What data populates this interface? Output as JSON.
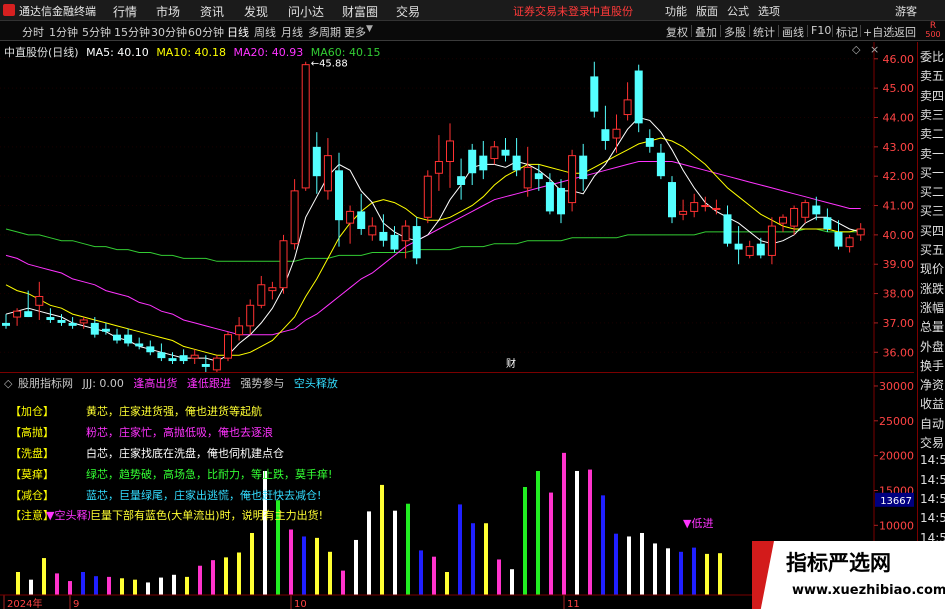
{
  "menubar": {
    "app_title": "通达信金融终端",
    "items": [
      "行情",
      "市场",
      "资讯",
      "发现",
      "问小达",
      "财富圈",
      "交易"
    ],
    "status_notice": "证券交易未登录",
    "stock_name": "中直股份",
    "right_items": [
      "功能",
      "版面",
      "公式",
      "选项"
    ],
    "guest": "游客"
  },
  "toolbar": {
    "periods": [
      "分时",
      "1分钟",
      "5分钟",
      "15分钟",
      "30分钟",
      "60分钟",
      "日线",
      "周线",
      "月线",
      "多周期",
      "更多"
    ],
    "active_period": "日线",
    "tools": [
      "复权",
      "叠加",
      "多股",
      "统计",
      "画线",
      "F10",
      "标记",
      "+自选",
      "返回"
    ],
    "badge_top": "R",
    "badge_bottom": "500"
  },
  "main_chart": {
    "title": "中直股份(日线)",
    "ma": [
      {
        "label": "MA5: 40.10",
        "color": "#ffffff"
      },
      {
        "label": "MA10: 40.18",
        "color": "#ffff00"
      },
      {
        "label": "MA20: 40.93",
        "color": "#ff33ff"
      },
      {
        "label": "MA60: 40.15",
        "color": "#33cc33"
      }
    ],
    "high_label": "45.88",
    "low_label": "34.48",
    "event_marker": "财"
  },
  "chart_data": {
    "type": "candlestick",
    "price_axis": [
      "46.00",
      "45.00",
      "44.00",
      "43.00",
      "42.00",
      "41.00",
      "40.00",
      "39.00",
      "38.00",
      "37.00",
      "36.00"
    ],
    "ylim": [
      35.6,
      46.3
    ],
    "candles": [
      [
        37.0,
        37.3,
        36.8,
        36.9
      ],
      [
        37.2,
        37.5,
        36.9,
        37.4
      ],
      [
        37.4,
        38.1,
        37.2,
        37.2
      ],
      [
        37.6,
        38.4,
        37.1,
        37.9
      ],
      [
        37.2,
        37.5,
        37.0,
        37.1
      ],
      [
        37.1,
        37.3,
        36.9,
        37.0
      ],
      [
        37.0,
        37.2,
        36.8,
        36.9
      ],
      [
        37.0,
        37.2,
        36.8,
        37.1
      ],
      [
        37.0,
        37.2,
        36.5,
        36.6
      ],
      [
        36.8,
        37.0,
        36.6,
        36.7
      ],
      [
        36.6,
        36.8,
        36.3,
        36.4
      ],
      [
        36.6,
        36.8,
        36.2,
        36.3
      ],
      [
        36.3,
        36.5,
        36.1,
        36.2
      ],
      [
        36.2,
        36.4,
        35.9,
        36.0
      ],
      [
        36.0,
        36.3,
        35.7,
        35.8
      ],
      [
        35.8,
        36.0,
        35.6,
        35.7
      ],
      [
        35.9,
        36.1,
        35.6,
        35.7
      ],
      [
        35.8,
        36.1,
        35.6,
        35.9
      ],
      [
        35.6,
        35.9,
        34.5,
        35.5
      ],
      [
        35.4,
        35.9,
        35.2,
        35.8
      ],
      [
        35.8,
        36.7,
        35.7,
        36.6
      ],
      [
        36.6,
        37.2,
        36.4,
        36.9
      ],
      [
        36.9,
        37.8,
        36.6,
        37.6
      ],
      [
        37.6,
        38.6,
        37.5,
        38.3
      ],
      [
        38.1,
        38.4,
        37.8,
        38.2
      ],
      [
        38.2,
        40.0,
        38.0,
        39.8
      ],
      [
        39.7,
        41.9,
        39.5,
        41.5
      ],
      [
        41.6,
        45.9,
        41.5,
        45.8
      ],
      [
        43.0,
        43.5,
        41.4,
        42.0
      ],
      [
        41.5,
        43.3,
        41.2,
        42.7
      ],
      [
        42.2,
        42.8,
        39.6,
        40.5
      ],
      [
        40.4,
        41.0,
        39.7,
        40.8
      ],
      [
        40.8,
        41.4,
        40.0,
        40.2
      ],
      [
        40.0,
        40.6,
        39.8,
        40.3
      ],
      [
        40.1,
        40.7,
        39.6,
        39.8
      ],
      [
        40.0,
        40.3,
        39.4,
        39.5
      ],
      [
        39.8,
        40.5,
        39.2,
        40.3
      ],
      [
        40.3,
        40.6,
        39.0,
        39.2
      ],
      [
        40.6,
        42.2,
        40.4,
        42.0
      ],
      [
        42.1,
        43.4,
        41.5,
        42.5
      ],
      [
        42.5,
        43.8,
        41.6,
        43.2
      ],
      [
        42.0,
        42.6,
        41.2,
        41.7
      ],
      [
        42.9,
        43.1,
        41.7,
        42.1
      ],
      [
        42.7,
        43.2,
        41.9,
        42.2
      ],
      [
        42.6,
        43.2,
        42.4,
        43.0
      ],
      [
        42.9,
        43.3,
        42.5,
        42.7
      ],
      [
        42.7,
        43.3,
        42.0,
        42.2
      ],
      [
        41.6,
        43.0,
        41.3,
        42.3
      ],
      [
        42.1,
        42.4,
        41.5,
        41.9
      ],
      [
        41.8,
        42.1,
        40.7,
        40.8
      ],
      [
        41.6,
        41.9,
        40.4,
        40.7
      ],
      [
        41.1,
        42.9,
        40.8,
        42.7
      ],
      [
        42.7,
        43.1,
        41.5,
        41.9
      ],
      [
        45.4,
        45.9,
        44.0,
        44.2
      ],
      [
        43.6,
        44.4,
        42.9,
        43.2
      ],
      [
        43.3,
        44.1,
        42.8,
        43.6
      ],
      [
        44.1,
        45.2,
        43.9,
        44.6
      ],
      [
        45.6,
        45.8,
        43.5,
        43.8
      ],
      [
        43.3,
        43.6,
        42.8,
        43.0
      ],
      [
        42.8,
        43.1,
        41.9,
        42.0
      ],
      [
        41.8,
        42.0,
        40.4,
        40.6
      ],
      [
        40.7,
        41.2,
        40.5,
        40.8
      ],
      [
        40.8,
        41.4,
        40.6,
        41.1
      ],
      [
        41.0,
        41.3,
        40.8,
        41.0
      ],
      [
        40.9,
        41.2,
        40.7,
        40.9
      ],
      [
        40.7,
        41.0,
        39.6,
        39.7
      ],
      [
        39.7,
        40.3,
        39.0,
        39.5
      ],
      [
        39.3,
        39.8,
        39.2,
        39.6
      ],
      [
        39.7,
        39.9,
        39.2,
        39.3
      ],
      [
        39.3,
        40.6,
        39.0,
        40.3
      ],
      [
        40.4,
        40.7,
        40.1,
        40.6
      ],
      [
        40.3,
        41.0,
        40.0,
        40.9
      ],
      [
        40.6,
        41.2,
        40.4,
        41.1
      ],
      [
        41.0,
        41.3,
        40.5,
        40.7
      ],
      [
        40.6,
        40.9,
        40.1,
        40.2
      ],
      [
        40.1,
        40.5,
        39.5,
        39.6
      ],
      [
        39.6,
        40.0,
        39.4,
        39.9
      ],
      [
        40.0,
        40.4,
        39.8,
        40.2
      ]
    ],
    "ma5": [
      37.3,
      37.4,
      37.5,
      37.4,
      37.3,
      37.2,
      37.0,
      36.9,
      36.8,
      36.7,
      36.5,
      36.4,
      36.2,
      36.1,
      36.0,
      35.9,
      35.8,
      35.8,
      35.8,
      35.7,
      35.9,
      36.3,
      36.6,
      37.0,
      37.5,
      38.2,
      39.2,
      40.6,
      41.3,
      42.0,
      42.4,
      42.2,
      41.5,
      41.1,
      40.4,
      40.1,
      39.9,
      39.8,
      40.0,
      40.5,
      41.2,
      41.7,
      42.3,
      42.4,
      42.4,
      42.3,
      42.5,
      42.4,
      42.2,
      41.9,
      41.5,
      41.5,
      41.4,
      42.0,
      42.4,
      43.0,
      43.6,
      44.0,
      43.9,
      43.5,
      42.9,
      42.2,
      41.6,
      41.1,
      40.8,
      40.6,
      40.4,
      40.1,
      39.8,
      39.7,
      39.8,
      40.0,
      40.4,
      40.6,
      40.6,
      40.4,
      40.2,
      40.1
    ],
    "ma10": [
      38.3,
      38.1,
      38.0,
      37.8,
      37.6,
      37.5,
      37.3,
      37.2,
      37.1,
      37.0,
      36.9,
      36.8,
      36.7,
      36.6,
      36.5,
      36.4,
      36.2,
      36.1,
      36.0,
      35.9,
      35.9,
      35.9,
      36.0,
      36.2,
      36.4,
      36.8,
      37.2,
      37.9,
      38.5,
      39.2,
      39.9,
      40.4,
      40.8,
      41.1,
      41.2,
      41.1,
      40.9,
      40.6,
      40.5,
      40.5,
      40.6,
      40.8,
      41.0,
      41.3,
      41.7,
      42.0,
      42.2,
      42.4,
      42.4,
      42.3,
      42.2,
      42.1,
      42.1,
      42.3,
      42.5,
      42.7,
      42.9,
      43.1,
      43.2,
      43.3,
      43.2,
      43.0,
      42.7,
      42.4,
      42.0,
      41.6,
      41.3,
      41.0,
      40.7,
      40.5,
      40.3,
      40.2,
      40.2,
      40.2,
      40.2,
      40.1,
      40.1,
      40.2
    ],
    "ma20": [
      39.3,
      39.2,
      39.0,
      38.9,
      38.8,
      38.7,
      38.5,
      38.4,
      38.3,
      38.1,
      38.0,
      37.9,
      37.7,
      37.6,
      37.4,
      37.3,
      37.1,
      37.0,
      36.9,
      36.8,
      36.7,
      36.6,
      36.6,
      36.6,
      36.6,
      36.7,
      36.8,
      37.1,
      37.3,
      37.6,
      37.9,
      38.2,
      38.5,
      38.7,
      39.0,
      39.3,
      39.6,
      39.8,
      40.0,
      40.2,
      40.4,
      40.6,
      40.8,
      41.0,
      41.2,
      41.3,
      41.4,
      41.5,
      41.6,
      41.7,
      41.8,
      41.9,
      42.0,
      42.1,
      42.2,
      42.3,
      42.4,
      42.5,
      42.5,
      42.5,
      42.5,
      42.4,
      42.3,
      42.2,
      42.1,
      42.0,
      41.9,
      41.8,
      41.7,
      41.6,
      41.5,
      41.4,
      41.3,
      41.2,
      41.1,
      41.0,
      40.9,
      40.9
    ],
    "ma60": [
      40.2,
      40.1,
      40.0,
      40.0,
      39.9,
      39.8,
      39.8,
      39.7,
      39.6,
      39.6,
      39.5,
      39.5,
      39.4,
      39.4,
      39.3,
      39.3,
      39.2,
      39.2,
      39.2,
      39.1,
      39.1,
      39.1,
      39.1,
      39.1,
      39.1,
      39.1,
      39.1,
      39.2,
      39.2,
      39.2,
      39.3,
      39.3,
      39.3,
      39.4,
      39.4,
      39.4,
      39.4,
      39.5,
      39.5,
      39.5,
      39.5,
      39.6,
      39.6,
      39.6,
      39.7,
      39.7,
      39.7,
      39.8,
      39.8,
      39.8,
      39.8,
      39.9,
      39.9,
      39.9,
      39.9,
      39.9,
      40.0,
      40.0,
      40.0,
      40.0,
      40.0,
      40.0,
      40.0,
      40.1,
      40.1,
      40.1,
      40.1,
      40.1,
      40.1,
      40.1,
      40.1,
      40.1,
      40.2,
      40.2,
      40.1,
      40.1,
      40.1,
      40.1
    ],
    "indicator": {
      "axis": [
        "30000",
        "25000",
        "20000",
        "15000",
        "10000",
        "5000"
      ],
      "ylim": [
        0,
        31000
      ],
      "current_value": "13667",
      "bars": [
        {
          "v": 3300,
          "c": "#ffff33"
        },
        {
          "v": 2200,
          "c": "#ffffff"
        },
        {
          "v": 5300,
          "c": "#ffff33"
        },
        {
          "v": 3100,
          "c": "#ff33cc"
        },
        {
          "v": 2000,
          "c": "#ff33cc"
        },
        {
          "v": 3300,
          "c": "#2020ff"
        },
        {
          "v": 2700,
          "c": "#2020ff"
        },
        {
          "v": 2600,
          "c": "#ff33cc"
        },
        {
          "v": 2400,
          "c": "#ffff33"
        },
        {
          "v": 2200,
          "c": "#ffff33"
        },
        {
          "v": 1800,
          "c": "#ffffff"
        },
        {
          "v": 2500,
          "c": "#ffffff"
        },
        {
          "v": 2900,
          "c": "#ffffff"
        },
        {
          "v": 2600,
          "c": "#ffff33"
        },
        {
          "v": 4200,
          "c": "#ff33cc"
        },
        {
          "v": 5000,
          "c": "#ff33cc"
        },
        {
          "v": 5400,
          "c": "#ffff33"
        },
        {
          "v": 6100,
          "c": "#ffff33"
        },
        {
          "v": 8900,
          "c": "#ffff33"
        },
        {
          "v": 17800,
          "c": "#ffffff"
        },
        {
          "v": 13600,
          "c": "#22ee22"
        },
        {
          "v": 9400,
          "c": "#ff33cc"
        },
        {
          "v": 8400,
          "c": "#2020ff"
        },
        {
          "v": 8200,
          "c": "#ffff33"
        },
        {
          "v": 6200,
          "c": "#ffff33"
        },
        {
          "v": 3500,
          "c": "#ff33cc"
        },
        {
          "v": 7900,
          "c": "#ffffff"
        },
        {
          "v": 12000,
          "c": "#ffffff"
        },
        {
          "v": 15800,
          "c": "#ffff33"
        },
        {
          "v": 12100,
          "c": "#ffffff"
        },
        {
          "v": 13100,
          "c": "#22ee22"
        },
        {
          "v": 6400,
          "c": "#2020ff"
        },
        {
          "v": 5500,
          "c": "#ff33cc"
        },
        {
          "v": 3300,
          "c": "#ffff33"
        },
        {
          "v": 13000,
          "c": "#2020ff"
        },
        {
          "v": 10300,
          "c": "#2020ff"
        },
        {
          "v": 10300,
          "c": "#ffff33"
        },
        {
          "v": 5100,
          "c": "#ff33cc"
        },
        {
          "v": 3700,
          "c": "#ffffff"
        },
        {
          "v": 15500,
          "c": "#22ee22"
        },
        {
          "v": 17800,
          "c": "#22ee22"
        },
        {
          "v": 14700,
          "c": "#ff33cc"
        },
        {
          "v": 20400,
          "c": "#ff33cc"
        },
        {
          "v": 17800,
          "c": "#ffffff"
        },
        {
          "v": 18000,
          "c": "#ff33cc"
        },
        {
          "v": 14300,
          "c": "#2020ff"
        },
        {
          "v": 8800,
          "c": "#2020ff"
        },
        {
          "v": 8400,
          "c": "#ffffff"
        },
        {
          "v": 8900,
          "c": "#ffffff"
        },
        {
          "v": 7400,
          "c": "#ffffff"
        },
        {
          "v": 6700,
          "c": "#ffffff"
        },
        {
          "v": 6200,
          "c": "#2020ff"
        },
        {
          "v": 6800,
          "c": "#2020ff"
        },
        {
          "v": 5900,
          "c": "#ffff33"
        },
        {
          "v": 6000,
          "c": "#ffff33"
        }
      ]
    },
    "x_ticks": [
      {
        "label": "2024年",
        "i": 0
      },
      {
        "label": "9",
        "i": 4
      },
      {
        "label": "10",
        "i": 21
      },
      {
        "label": "11",
        "i": 42
      }
    ]
  },
  "indicator_panel": {
    "name": "股朋指标网",
    "value": "JJJ: 0.00",
    "tags": [
      {
        "text": "逢高出货",
        "color": "#ffffff"
      },
      {
        "text": "逢低跟进",
        "color": "#ffffff"
      },
      {
        "text": "强势参与",
        "color": "#ffffff"
      },
      {
        "text": "空头释放",
        "color": "#33ddff"
      }
    ],
    "rows": [
      {
        "tag": "【加仓】",
        "text": "黄芯，庄家进货强，俺也进货等起航",
        "color": "#ffff33"
      },
      {
        "tag": "【高抛】",
        "text": "粉芯，庄家忙，高抛低吸，俺也去逐浪",
        "color": "#ff33ff"
      },
      {
        "tag": "【洗盘】",
        "text": "白芯，庄家找底在洗盘，俺也伺机建点仓",
        "color": "#ffffff"
      },
      {
        "tag": "【莫痒】",
        "text": "绿芯，趋势破，高场急，比耐力，等止跌，莫手痒!",
        "color": "#33ff33"
      },
      {
        "tag": "【减仓】",
        "text": "蓝芯，巨量绿尾，庄家出逃慌，俺也赶快去减仓!",
        "color": "#33ddff"
      },
      {
        "tag": "【注意】",
        "text": "巨量下部有蓝色(大单流出)时，说明有主力出货!",
        "color": "#ffff33"
      }
    ],
    "overlay_marker": "▼空头释放",
    "dip_marker": "▼低进"
  },
  "quote_panel": {
    "items": [
      "委比",
      "卖五",
      "卖四",
      "卖三",
      "卖二",
      "卖一",
      "买一",
      "买二",
      "买三",
      "买四",
      "买五",
      "现价",
      "涨跌",
      "涨幅",
      "总量",
      "外盘",
      "换手",
      "净资",
      "收益",
      "自动",
      "交易",
      "14:56",
      "14:56",
      "14:56",
      "14:56",
      "14:56",
      "14:56",
      "14:56",
      "14:56"
    ]
  },
  "watermark": {
    "title": "指标严选网",
    "url": "www.xuezhibiao.com"
  }
}
